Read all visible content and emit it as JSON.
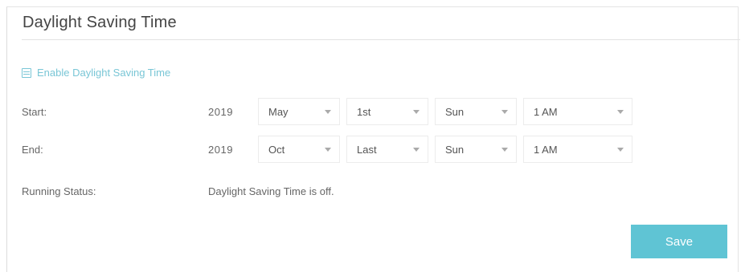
{
  "section": {
    "title": "Daylight Saving Time"
  },
  "enable_dst": {
    "label": "Enable Daylight Saving Time",
    "checked": true
  },
  "start": {
    "label": "Start:",
    "year": "2019",
    "month": "May",
    "week": "1st",
    "day": "Sun",
    "hour": "1 AM"
  },
  "end": {
    "label": "End:",
    "year": "2019",
    "month": "Oct",
    "week": "Last",
    "day": "Sun",
    "hour": "1 AM"
  },
  "status": {
    "label": "Running Status:",
    "value": "Daylight Saving Time is off."
  },
  "actions": {
    "save_label": "Save"
  },
  "colors": {
    "accent": "#5fc4d4",
    "link": "#79c6d6"
  }
}
